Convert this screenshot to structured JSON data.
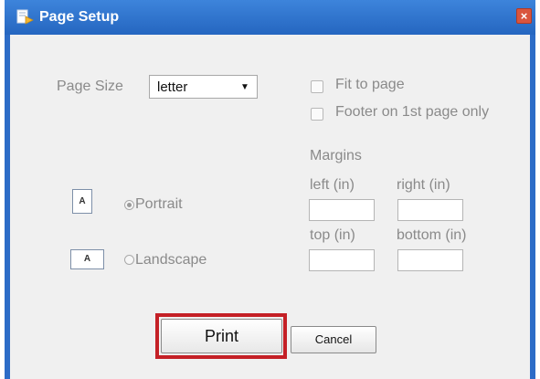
{
  "window": {
    "title": "Page Setup",
    "close_label": "×",
    "accent_color": "#2c6cc7"
  },
  "page_size": {
    "label": "Page Size",
    "selected": "letter",
    "arrow": "▼"
  },
  "options": {
    "fit_to_page": {
      "label": "Fit to page",
      "checked": false
    },
    "footer_first_page": {
      "label": "Footer on 1st page only",
      "checked": false
    }
  },
  "orientation": {
    "icon_letter": "A",
    "portrait_label": "Portrait",
    "landscape_label": "Landscape",
    "selected": "portrait"
  },
  "margins": {
    "heading": "Margins",
    "left_label": "left (in)",
    "right_label": "right (in)",
    "top_label": "top (in)",
    "bottom_label": "bottom (in)",
    "left_value": "",
    "right_value": "",
    "top_value": "",
    "bottom_value": ""
  },
  "actions": {
    "print_label": "Print",
    "cancel_label": "Cancel",
    "highlight_color": "#c42026"
  }
}
